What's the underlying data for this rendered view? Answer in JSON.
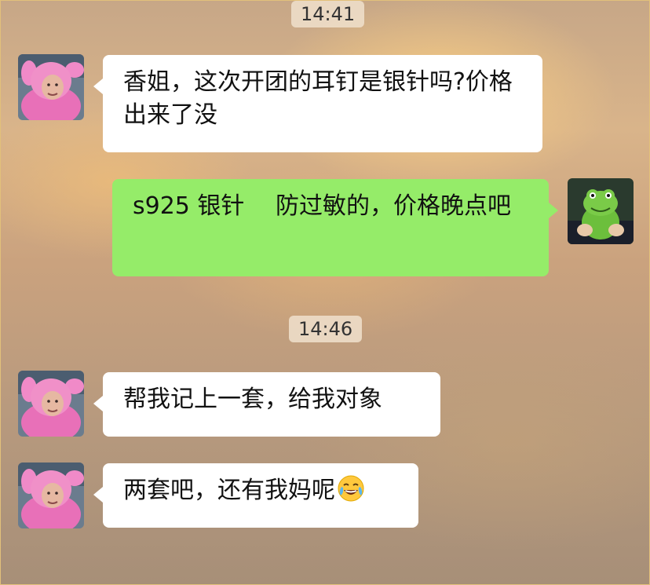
{
  "timestamps": [
    "14:41",
    "14:46"
  ],
  "messages": [
    {
      "side": "in",
      "text": "香姐，这次开团的耳钉是银针吗?价格出来了没"
    },
    {
      "side": "out",
      "text": "s925 银针　 防过敏的，价格晚点吧"
    },
    {
      "side": "in",
      "text": "帮我记上一套，给我对象"
    },
    {
      "side": "in",
      "text": "两套吧，还有我妈呢",
      "emoji": "laughing-crying-emoji"
    }
  ],
  "colors": {
    "incoming_bubble": "#ffffff",
    "outgoing_bubble": "#95ec69",
    "timestamp_chip": "#f0e1cd"
  },
  "icons": {
    "contact_avatar": "pink-bunny-costume-avatar",
    "self_avatar": "green-frog-plush-avatar"
  }
}
